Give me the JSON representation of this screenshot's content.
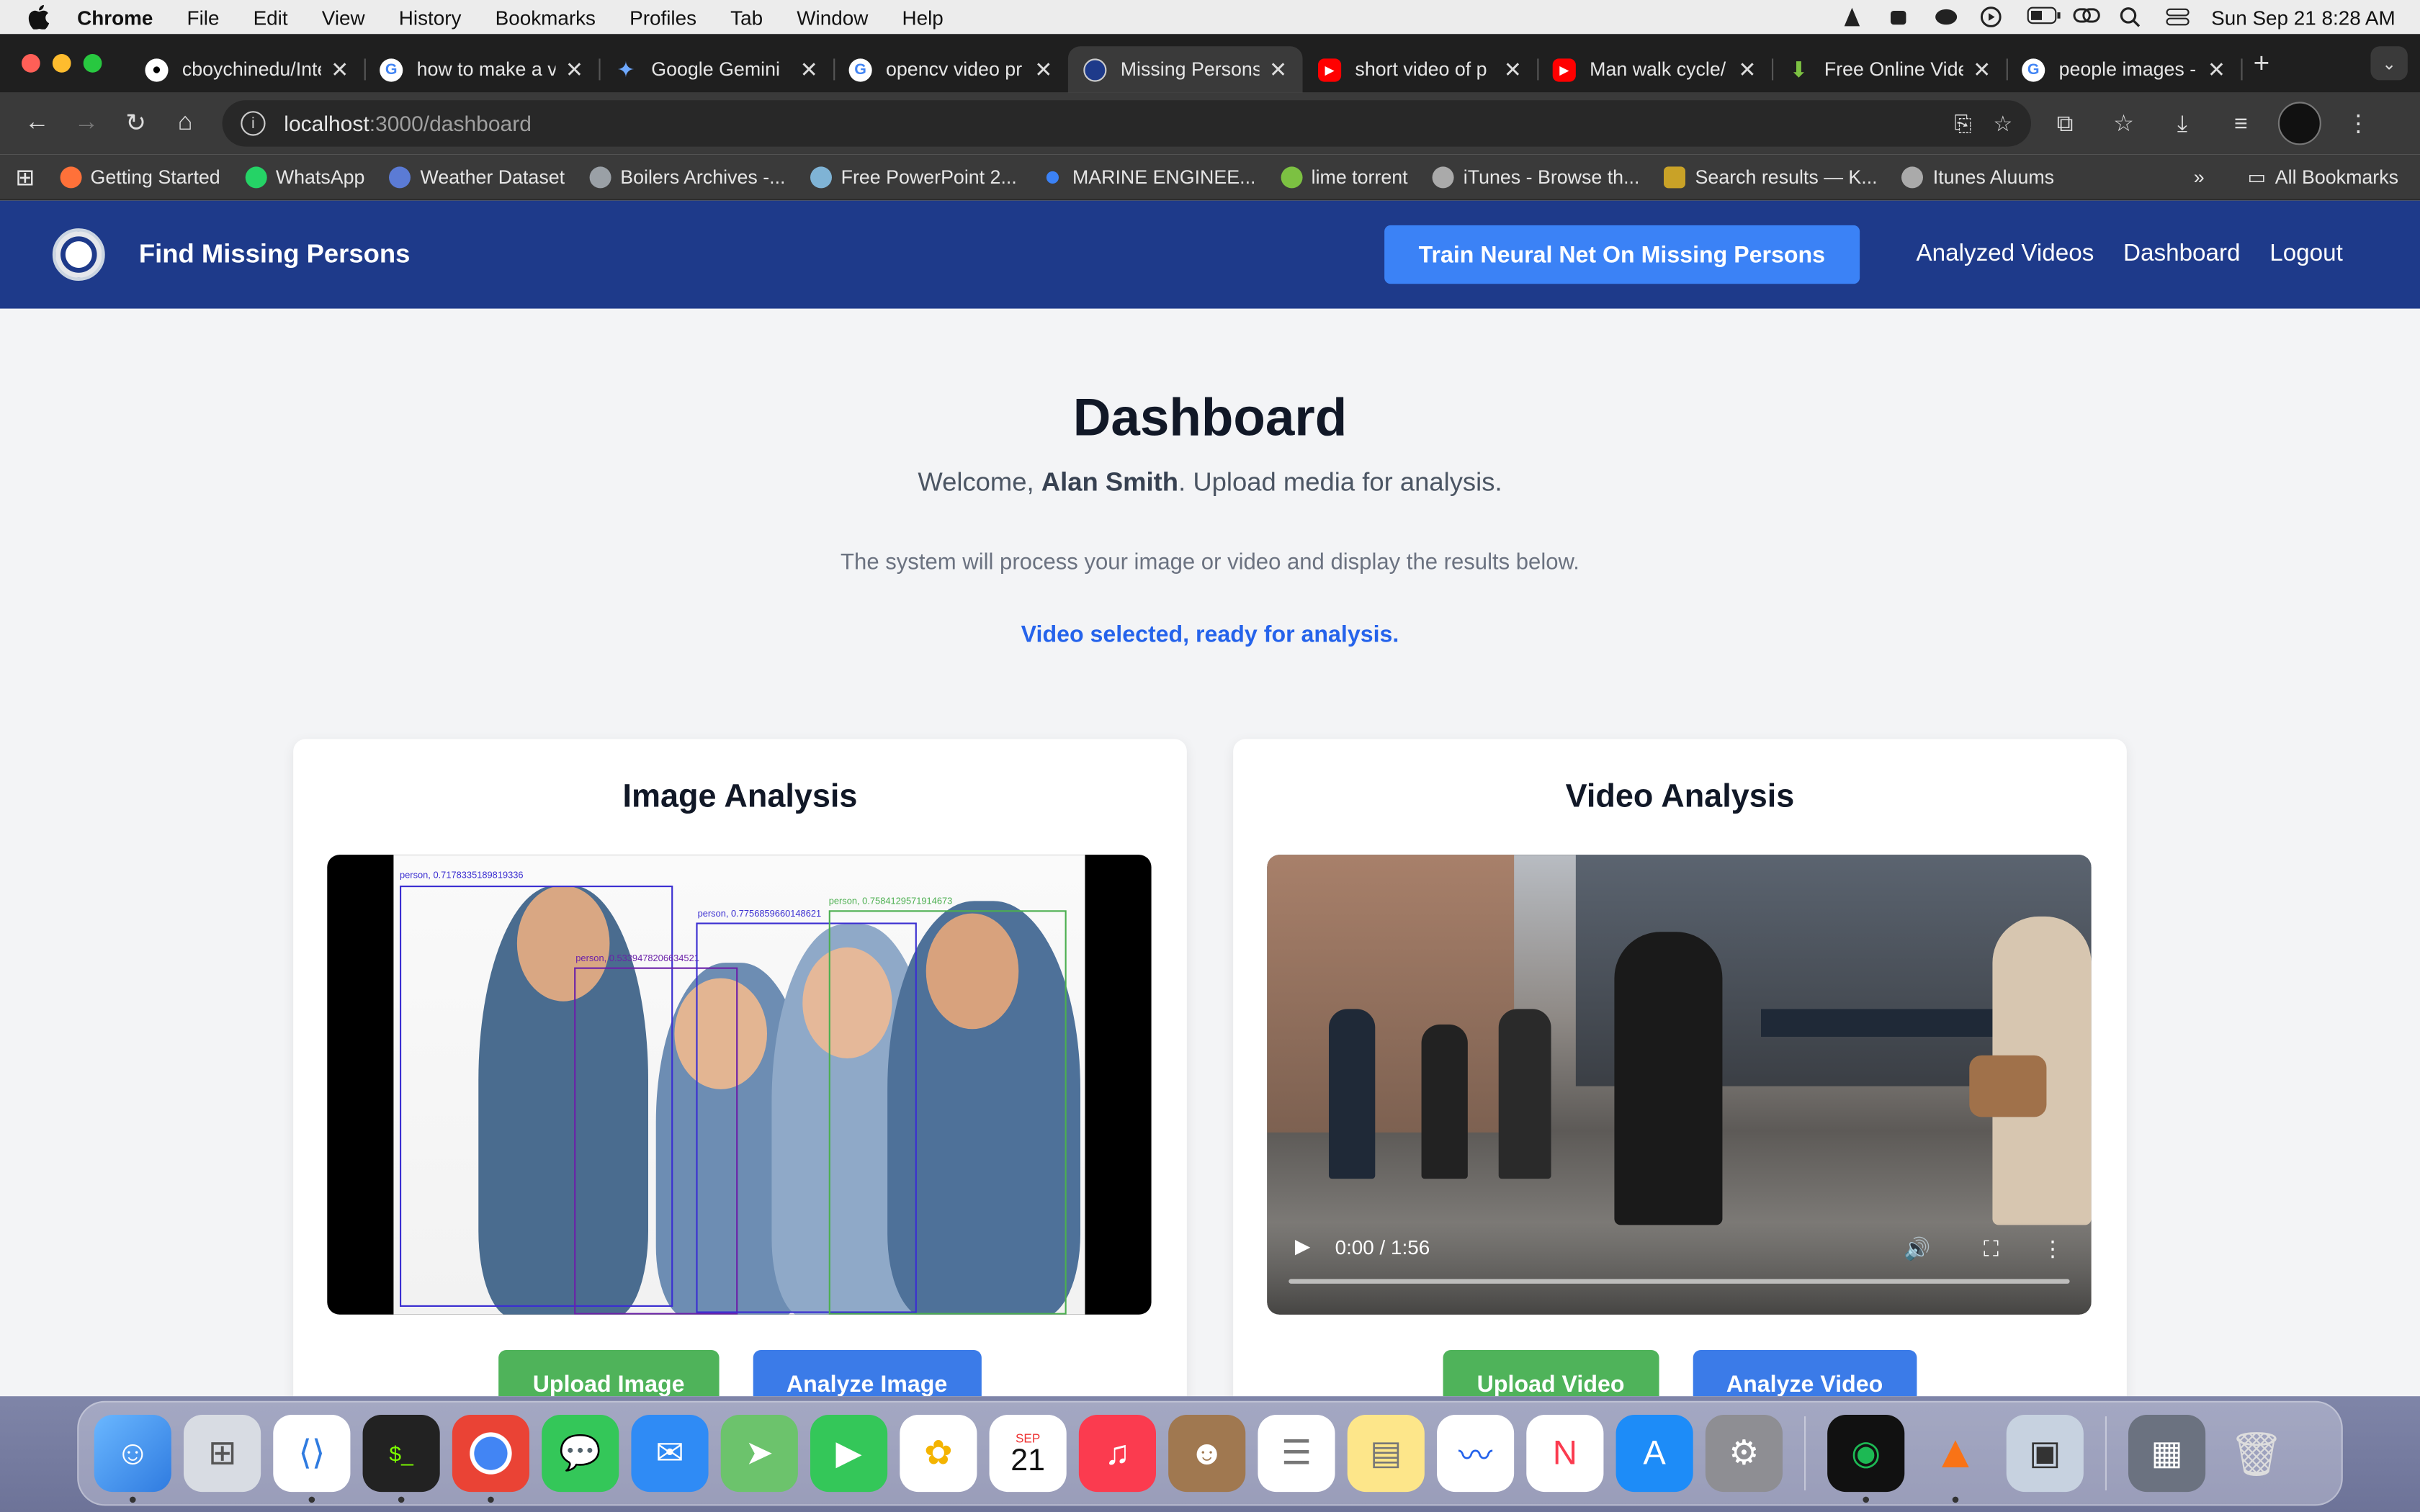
{
  "menubar": {
    "app": "Chrome",
    "items": [
      "File",
      "Edit",
      "View",
      "History",
      "Bookmarks",
      "Profiles",
      "Tab",
      "Window",
      "Help"
    ],
    "datetime": "Sun Sep 21  8:28 AM"
  },
  "tabs": [
    {
      "title": "cboychinedu/Inte",
      "fav_color": "#ffffff",
      "icon": "github-icon"
    },
    {
      "title": "how to make a v",
      "fav_color": "#ffffff",
      "icon": "google-icon"
    },
    {
      "title": "Google Gemini",
      "fav_color": "#4b8bf5",
      "icon": "gemini-icon"
    },
    {
      "title": "opencv video pr",
      "fav_color": "#ffffff",
      "icon": "google-icon"
    },
    {
      "title": "Missing Persons",
      "fav_color": "#1e3a8a",
      "icon": "seal-icon",
      "active": true
    },
    {
      "title": "short video of p",
      "fav_color": "#ff0000",
      "icon": "youtube-icon"
    },
    {
      "title": "Man walk cycle/",
      "fav_color": "#ff0000",
      "icon": "youtube-icon"
    },
    {
      "title": "Free Online Vide",
      "fav_color": "#7cc142",
      "icon": "download-icon"
    },
    {
      "title": "people images -",
      "fav_color": "#ffffff",
      "icon": "google-icon"
    }
  ],
  "omnibox": {
    "host": "localhost",
    "path": ":3000/dashboard"
  },
  "bookmarks": [
    {
      "label": "Getting Started",
      "color": "#ff7139"
    },
    {
      "label": "WhatsApp",
      "color": "#25d366"
    },
    {
      "label": "Weather Dataset",
      "color": "#5b7bd5"
    },
    {
      "label": "Boilers Archives -...",
      "color": "#9aa0a6"
    },
    {
      "label": "Free PowerPoint 2...",
      "color": "#7fb3d5"
    },
    {
      "label": "MARINE ENGINEE...",
      "color": "#3b82f6"
    },
    {
      "label": "lime torrent",
      "color": "#7cc142"
    },
    {
      "label": "iTunes - Browse th...",
      "color": "#aaaaaa"
    },
    {
      "label": "Search results — K...",
      "color": "#c9a227"
    },
    {
      "label": "Itunes Aluums",
      "color": "#aaaaaa"
    }
  ],
  "bookmarks_all": "All Bookmarks",
  "nav": {
    "brand": "Find Missing Persons",
    "train_button": "Train Neural Net On Missing Persons",
    "links": [
      "Analyzed Videos",
      "Dashboard",
      "Logout"
    ]
  },
  "hero": {
    "title": "Dashboard",
    "welcome_prefix": "Welcome, ",
    "user": "Alan Smith",
    "welcome_suffix": ". Upload media for analysis.",
    "description": "The system will process your image or video and display the results below.",
    "status": "Video selected, ready for analysis."
  },
  "image_card": {
    "title": "Image Analysis",
    "upload": "Upload Image",
    "analyze": "Analyze Image",
    "detections": [
      {
        "label": "person, 0.7178335189819336",
        "color": "#3b2fd1"
      },
      {
        "label": "person, 0.5339478206634521",
        "color": "#6b21a8"
      },
      {
        "label": "person, 0.7756859660148621",
        "color": "#3b2fd1"
      },
      {
        "label": "person, 0.7584129571914673",
        "color": "#4caf50"
      }
    ]
  },
  "video_card": {
    "title": "Video Analysis",
    "time": "0:00 / 1:56",
    "upload": "Upload Video",
    "analyze": "Analyze Video"
  },
  "dock": {
    "calendar_month": "SEP",
    "calendar_day": "21"
  }
}
